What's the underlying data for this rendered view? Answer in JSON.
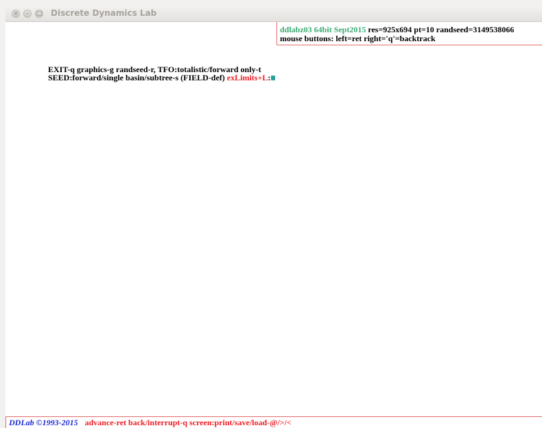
{
  "window": {
    "title": "Discrete Dynamics Lab",
    "close_glyph": "×",
    "minimize_glyph": "–",
    "maximize_glyph": "□"
  },
  "info": {
    "version": "ddlabz03 64bit Sept2015",
    "params": " res=925x694 pt=10 randseed=3149538066",
    "mouse": "mouse buttons: left=ret right='q'=backtrack"
  },
  "menu": {
    "line1": "EXIT-q graphics-g randseed-r, TFO:totalistic/forward only-t",
    "line2": "SEED:forward/single basin/subtree-s (FIELD-def) ",
    "exlimits": "exLimits+L",
    "colon": ":"
  },
  "status": {
    "brand": "DDLab ©1993-2015",
    "commands": "advance-ret back/interrupt-q  screen:print/save/load-@/>/<"
  },
  "colors": {
    "accent_green": "#3bab72",
    "accent_red": "#ee1c24",
    "brand_blue": "#1b2bd6",
    "cursor_teal": "#2f9e9a",
    "border_red": "#e26b6b"
  },
  "icons": {
    "close": "close-icon",
    "minimize": "minimize-icon",
    "maximize": "maximize-icon",
    "cursor": "input-cursor-block"
  }
}
